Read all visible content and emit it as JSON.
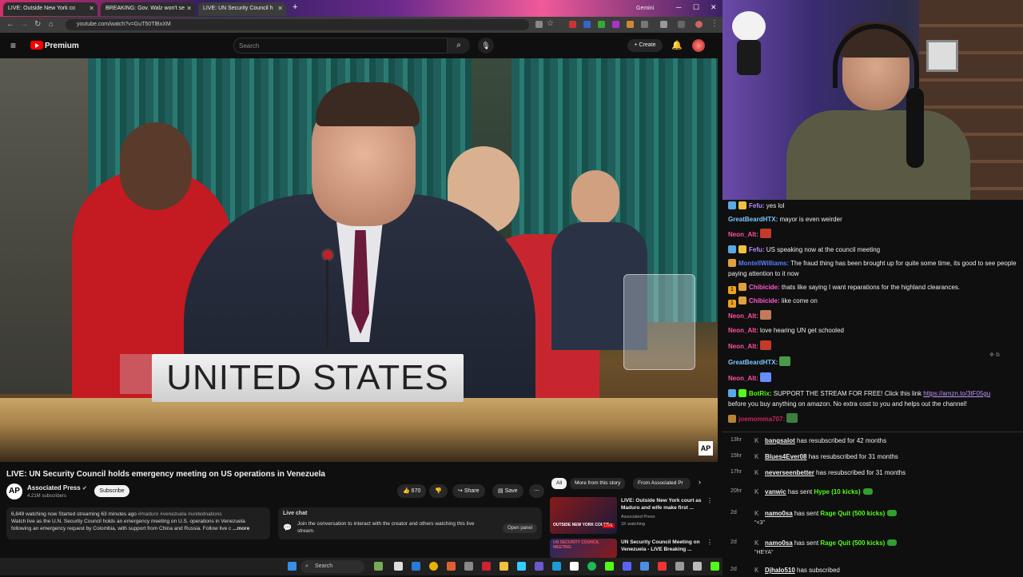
{
  "browser": {
    "tabs": [
      {
        "label": "LIVE: Outside New York co"
      },
      {
        "label": "BREAKING: Gov. Walz won't se"
      },
      {
        "label": "LIVE: UN Security Council h"
      },
      {
        "label": "Gemini"
      }
    ],
    "url": "youtube.com/watch?v=GuT50TlBxXM"
  },
  "youtube": {
    "brand": "Premium",
    "search_placeholder": "Search",
    "create_label": "Create"
  },
  "video": {
    "nameplate": "UNITED STATES",
    "watermark": "AP",
    "title": "LIVE: UN Security Council holds emergency meeting on US operations in Venezuela",
    "channel": {
      "avatar": "AP",
      "name": "Associated Press",
      "subscribers": "4.21M subscribers"
    },
    "subscribe_label": "Subscribe",
    "likes": "670",
    "share_label": "Share",
    "save_label": "Save",
    "description": {
      "stats": "6,849 watching now  Started streaming 63 minutes ago",
      "hashtags": "#maduro #venezuela #unitednations",
      "text": "Watch live as the U.N. Security Council holds an emergency meeting on U.S. operations in Venezuela following an emergency request by Colombia, with support from China and Russia. Follow live c",
      "more": "...more"
    },
    "live_chat": {
      "title": "Live chat",
      "text": "Join the conversation to interact with the creator and others watching this live stream.",
      "button": "Open panel"
    }
  },
  "recommendations": {
    "chips": [
      "All",
      "More from this story",
      "From Associated Pr"
    ],
    "items": [
      {
        "title": "LIVE: Outside New York court as Maduro and wife make first ...",
        "channel": "Associated Press",
        "meta": "1K watching",
        "badge": "LIVE",
        "thumb_text": "OUTSIDE NEW YORK COURT"
      },
      {
        "title": "UN Security Council Meeting on Venezuela - LIVE Breaking ...",
        "channel": "",
        "meta": "",
        "badge": "",
        "thumb_text": "UN SECURITY COUNCIL MEETING"
      }
    ]
  },
  "taskbar": {
    "search_label": "Search"
  },
  "chat": {
    "messages": [
      {
        "user": "Fefu:",
        "user_color": "#b48cff",
        "text": "yes lol",
        "badges": [
          "#5aa9e6",
          "#f0c040"
        ]
      },
      {
        "user": "GreatBeardHTX:",
        "user_color": "#7ec8ff",
        "text": "mayor is even weirder",
        "badges": []
      },
      {
        "user": "Neon_Alt:",
        "user_color": "#ff4fa3",
        "text": "",
        "badges": [],
        "emote": "#c43a2a"
      },
      {
        "user": "Fefu:",
        "user_color": "#b48cff",
        "text": "US speaking now at the council meeting",
        "badges": [
          "#5aa9e6",
          "#f0c040"
        ]
      },
      {
        "user": "MontellWilliams:",
        "user_color": "#5a7cff",
        "text": "The fraud thing has been brought up for quite some time, its good to see people paying attention to it now",
        "badges": [
          "#e0a040"
        ]
      },
      {
        "user": "Chibicide:",
        "user_color": "#ff5ad0",
        "text": "thats like saying I want reparations for the highland clearances.",
        "badges": [
          "#f0a020",
          "#e0a040"
        ],
        "badge_text": "1"
      },
      {
        "user": "Chibicide:",
        "user_color": "#ff5ad0",
        "text": "like come on",
        "badges": [
          "#f0a020",
          "#e0a040"
        ],
        "badge_text": "1"
      },
      {
        "user": "Neon_Alt:",
        "user_color": "#ff4fa3",
        "text": "",
        "badges": [],
        "emote": "#c47a5a"
      },
      {
        "user": "Neon_Alt:",
        "user_color": "#ff4fa3",
        "text": "love hearing UN get schooled",
        "badges": []
      },
      {
        "user": "Neon_Alt:",
        "user_color": "#ff4fa3",
        "text": "",
        "badges": [],
        "emote": "#c43a2a"
      },
      {
        "user": "GreatBeardHTX:",
        "user_color": "#7ec8ff",
        "text": "",
        "badges": [],
        "emote": "#4a9a4a"
      },
      {
        "user": "Neon_Alt:",
        "user_color": "#ff4fa3",
        "text": "",
        "badges": [],
        "emote": "#6a8aff"
      },
      {
        "user": "BotRix:",
        "user_color": "#53fc18",
        "text": "SUPPORT THE STREAM FOR FREE! Click this link ",
        "link": "https://amzn.to/3tF05gu",
        "text2": "before you buy anything on amazon. No extra cost to you and helps out the channel!",
        "badges": [
          "#5aa9e6",
          "#53fc18"
        ]
      },
      {
        "user": "joemomma707:",
        "user_color": "#ff2a6a",
        "text": "",
        "badges": [
          "#e0a040"
        ],
        "emote": "#4a9a4a"
      }
    ]
  },
  "events": [
    {
      "time": "13hr",
      "user": "bangsalot",
      "action": "has resubscribed for 42 months",
      "green": "",
      "note": ""
    },
    {
      "time": "15hr",
      "user": "Blues4Ever08",
      "action": "has resubscribed for 31 months",
      "green": "",
      "note": ""
    },
    {
      "time": "17hr",
      "user": "neverseenbetter",
      "action": "has resubscribed for 31 months",
      "green": "",
      "note": ""
    },
    {
      "time": "20hr",
      "user": "vanwic",
      "action": "has sent",
      "green": "Hype (10 kicks)",
      "note": ""
    },
    {
      "time": "2d",
      "user": "namo0sa",
      "action": "has sent",
      "green": "Rage Quit (500 kicks)",
      "note": "\"<3\""
    },
    {
      "time": "2d",
      "user": "namo0sa",
      "action": "has sent",
      "green": "Rage Quit (500 kicks)",
      "note": "\"HEYA\""
    },
    {
      "time": "2d",
      "user": "Djhalo510",
      "action": "has subscribed",
      "green": "",
      "note": ""
    }
  ]
}
